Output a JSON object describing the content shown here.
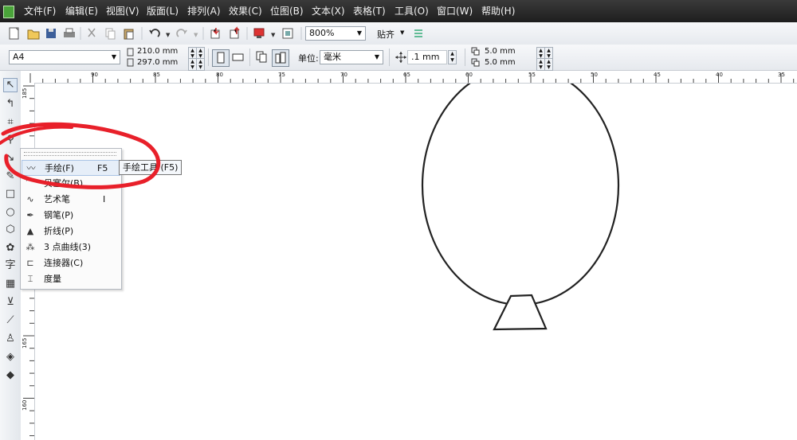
{
  "menubar": {
    "items": [
      "文件(F)",
      "编辑(E)",
      "视图(V)",
      "版面(L)",
      "排列(A)",
      "效果(C)",
      "位图(B)",
      "文本(X)",
      "表格(T)",
      "工具(O)",
      "窗口(W)",
      "帮助(H)"
    ]
  },
  "toolbar": {
    "zoom_value": "800%",
    "snap_label": "贴齐"
  },
  "properties": {
    "page_size": "A4",
    "width": "210.0 mm",
    "height": "297.0 mm",
    "unit_label": "单位:",
    "unit_value": "毫米",
    "nudge": ".1 mm",
    "dup_x": "5.0 mm",
    "dup_y": "5.0 mm"
  },
  "rulers": {
    "horizontal_labels": [
      "90",
      "85",
      "80",
      "75",
      "70",
      "65",
      "60",
      "55",
      "50",
      "45",
      "40",
      "35"
    ],
    "vertical_labels": [
      "185",
      "165",
      "160"
    ]
  },
  "toolbox": {
    "tools": [
      "pick-tool-icon",
      "shape-tool-icon",
      "crop-tool-icon",
      "zoom-tool-icon",
      "curve-tool-icon",
      "smart-fill-icon",
      "rectangle-tool-icon",
      "ellipse-tool-icon",
      "polygon-tool-icon",
      "basic-shapes-icon",
      "text-tool-icon",
      "table-tool-icon",
      "dimension-icon",
      "eyedropper-icon",
      "outline-pen-icon",
      "fill-tool-icon",
      "interactive-fill-icon"
    ]
  },
  "flyout": {
    "items": [
      {
        "label": "手绘(F)",
        "shortcut": "F5",
        "icon": "freehand-icon"
      },
      {
        "label": "贝塞尔(B)",
        "shortcut": "",
        "icon": "bezier-icon"
      },
      {
        "label": "艺术笔",
        "shortcut": "I",
        "icon": "artistic-media-icon"
      },
      {
        "label": "钢笔(P)",
        "shortcut": "",
        "icon": "pen-icon"
      },
      {
        "label": "折线(P)",
        "shortcut": "",
        "icon": "polyline-icon"
      },
      {
        "label": "3 点曲线(3)",
        "shortcut": "",
        "icon": "three-point-curve-icon"
      },
      {
        "label": "连接器(C)",
        "shortcut": "",
        "icon": "connector-icon"
      },
      {
        "label": "度量",
        "shortcut": "",
        "icon": "dimension-icon"
      }
    ]
  },
  "tooltip": "手绘工具 (F5)",
  "colors": {
    "highlight_circle": "#e8202a",
    "menubar": "#2a2a2a",
    "drawing_stroke": "#222222"
  }
}
